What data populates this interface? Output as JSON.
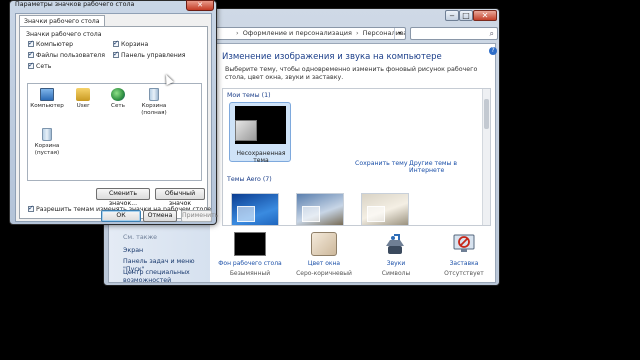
{
  "personalization_window": {
    "address": {
      "segments": [
        "Оформление и персонализация",
        "Персонализация"
      ],
      "separator": "›"
    },
    "search_placeholder": "",
    "heading": "Изменение изображения и звука на компьютере",
    "description": "Выберите тему, чтобы одновременно изменить фоновый рисунок рабочего стола, цвет окна, звуки и заставку.",
    "sidebar_links": [
      "См. также",
      "Экран",
      "Панель задач и меню \"Пуск\"",
      "Центр специальных возможностей"
    ],
    "themes": {
      "my_themes_header": "Мои темы (1)",
      "unsaved_theme_label": "Несохраненная тема",
      "save_theme_link": "Сохранить тему",
      "online_themes_link": "Другие темы в Интернете",
      "aero_themes_header": "Темы Aero (7)"
    },
    "bottom_items": [
      {
        "label": "Фон рабочего стола",
        "value": "Безымянный"
      },
      {
        "label": "Цвет окна",
        "value": "Серо-коричневый"
      },
      {
        "label": "Звуки",
        "value": "Символы"
      },
      {
        "label": "Заставка",
        "value": "Отсутствует"
      }
    ]
  },
  "dialog": {
    "title": "Параметры значков рабочего стола",
    "tab": "Значки рабочего стола",
    "group_label": "Значки рабочего стола",
    "checkboxes": [
      {
        "label": "Компьютер",
        "checked": true
      },
      {
        "label": "Файлы пользователя",
        "checked": true
      },
      {
        "label": "Сеть",
        "checked": true
      },
      {
        "label": "Корзина",
        "checked": true
      },
      {
        "label": "Панель управления",
        "checked": true
      }
    ],
    "icons": [
      {
        "label": "Компьютер",
        "icon": "computer-icon"
      },
      {
        "label": "User",
        "icon": "user-folder-icon"
      },
      {
        "label": "Сеть",
        "icon": "network-icon"
      },
      {
        "label": "Корзина (полная)",
        "icon": "recycle-bin-full-icon"
      },
      {
        "label": "Корзина (пустая)",
        "icon": "recycle-bin-empty-icon"
      }
    ],
    "change_icon_button": "Сменить значок...",
    "default_icon_button": "Обычный значок",
    "allow_themes_checkbox": {
      "label": "Разрешить темам изменять значки на рабочем столе",
      "checked": true
    },
    "ok_button": "ОК",
    "cancel_button": "Отмена",
    "apply_button": "Применить"
  },
  "colors": {
    "link": "#1a4fa8",
    "heading": "#1c3f8a",
    "desktop": "#000000",
    "window_frame": "#b9c6d7"
  }
}
